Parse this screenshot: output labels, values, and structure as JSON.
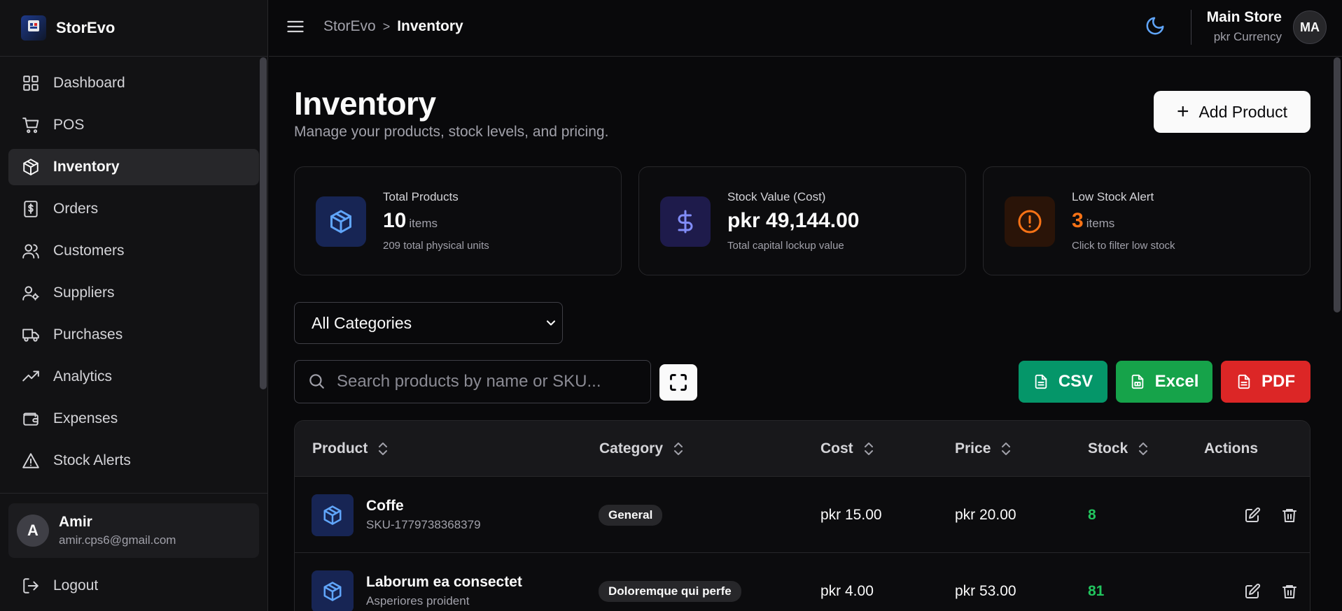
{
  "brand": {
    "name": "StorEvo",
    "logo_text": "StorEvo"
  },
  "sidebar": {
    "items": [
      {
        "label": "Dashboard",
        "icon": "grid-icon"
      },
      {
        "label": "POS",
        "icon": "cart-icon"
      },
      {
        "label": "Inventory",
        "icon": "box-icon",
        "active": true
      },
      {
        "label": "Orders",
        "icon": "receipt-icon"
      },
      {
        "label": "Customers",
        "icon": "users-icon"
      },
      {
        "label": "Suppliers",
        "icon": "user-cog-icon"
      },
      {
        "label": "Purchases",
        "icon": "truck-icon"
      },
      {
        "label": "Analytics",
        "icon": "trending-up-icon"
      },
      {
        "label": "Expenses",
        "icon": "wallet-icon"
      },
      {
        "label": "Stock Alerts",
        "icon": "alert-triangle-icon"
      }
    ],
    "user": {
      "initial": "A",
      "name": "Amir",
      "email": "amir.cps6@gmail.com"
    },
    "logout_label": "Logout"
  },
  "topbar": {
    "breadcrumb_root": "StorEvo",
    "breadcrumb_separator": ">",
    "breadcrumb_current": "Inventory",
    "store_name": "Main Store",
    "store_currency": "pkr Currency",
    "store_initials": "MA"
  },
  "page": {
    "title": "Inventory",
    "subtitle": "Manage your products, stock levels, and pricing.",
    "add_button": "Add Product"
  },
  "stats": [
    {
      "label": "Total Products",
      "value": "10",
      "unit": "items",
      "sub": "209 total physical units",
      "color": "#60a5fa"
    },
    {
      "label": "Stock Value (Cost)",
      "value": "pkr 49,144.00",
      "unit": "",
      "sub": "Total capital lockup value",
      "color": "#818cf8"
    },
    {
      "label": "Low Stock Alert",
      "value": "3",
      "unit": "items",
      "sub": "Click to filter low stock",
      "color": "#f97316"
    }
  ],
  "filters": {
    "category_selected": "All Categories",
    "search_placeholder": "Search products by name or SKU..."
  },
  "exports": {
    "csv": "CSV",
    "excel": "Excel",
    "pdf": "PDF"
  },
  "table": {
    "columns": [
      "Product",
      "Category",
      "Cost",
      "Price",
      "Stock",
      "Actions"
    ],
    "rows": [
      {
        "name": "Coffe",
        "sku": "SKU-1779738368379",
        "category": "General",
        "cost": "pkr 15.00",
        "price": "pkr 20.00",
        "stock": "8"
      },
      {
        "name": "Laborum ea consectet",
        "sku": "Asperiores proident",
        "category": "Doloremque qui perfe",
        "cost": "pkr 4.00",
        "price": "pkr 53.00",
        "stock": "81"
      }
    ]
  },
  "colors": {
    "accent": "#60a5fa",
    "csv": "#059669",
    "excel": "#16a34a",
    "pdf": "#dc2626",
    "stock_ok": "#22c55e",
    "warning": "#f97316"
  }
}
